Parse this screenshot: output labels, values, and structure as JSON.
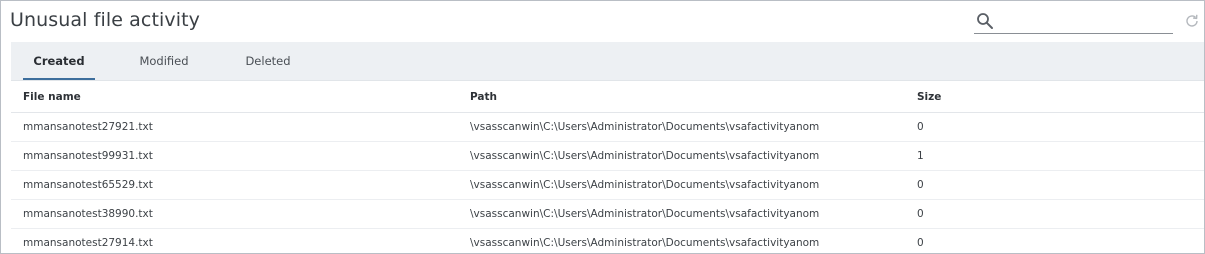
{
  "title": "Unusual file activity",
  "search": {
    "value": "",
    "placeholder": ""
  },
  "tabs": [
    {
      "label": "Created",
      "active": true
    },
    {
      "label": "Modified",
      "active": false
    },
    {
      "label": "Deleted",
      "active": false
    }
  ],
  "table": {
    "columns": [
      "File name",
      "Path",
      "Size"
    ],
    "rows": [
      {
        "file": "mmansanotest27921.txt",
        "path": "\\vsasscanwin\\C:\\Users\\Administrator\\Documents\\vsafactivityanom",
        "size": "0"
      },
      {
        "file": "mmansanotest99931.txt",
        "path": "\\vsasscanwin\\C:\\Users\\Administrator\\Documents\\vsafactivityanom",
        "size": "1"
      },
      {
        "file": "mmansanotest65529.txt",
        "path": "\\vsasscanwin\\C:\\Users\\Administrator\\Documents\\vsafactivityanom",
        "size": "0"
      },
      {
        "file": "mmansanotest38990.txt",
        "path": "\\vsasscanwin\\C:\\Users\\Administrator\\Documents\\vsafactivityanom",
        "size": "0"
      },
      {
        "file": "mmansanotest27914.txt",
        "path": "\\vsasscanwin\\C:\\Users\\Administrator\\Documents\\vsafactivityanom",
        "size": "0"
      }
    ]
  },
  "icons": {
    "search": "search-icon",
    "refresh": "refresh-icon"
  },
  "colors": {
    "tab_underline": "#3d6e9c",
    "tabbar_bg": "#edf0f3"
  }
}
